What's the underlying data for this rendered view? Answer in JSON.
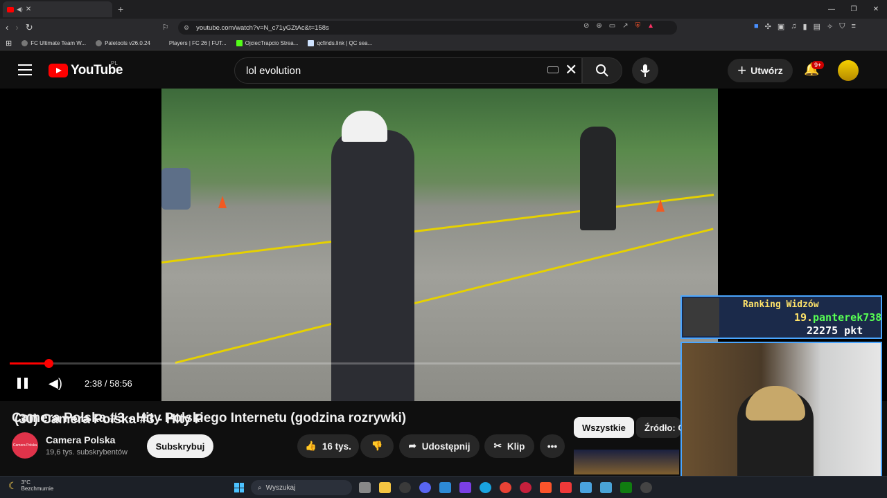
{
  "browser": {
    "tab_title": "(30) Camera Polska #3 - Hity P",
    "url": "youtube.com/watch?v=N_c71yGZtAc&t=158s",
    "bookmarks": [
      {
        "label": "FC Ultimate Team W..."
      },
      {
        "label": "Paletools v26.0.24"
      },
      {
        "label": "Players | FC 26 | FUT..."
      },
      {
        "label": "OjciecTrapcio Strea..."
      },
      {
        "label": "qcfinds.link | QC sea..."
      }
    ]
  },
  "header": {
    "logo_text": "YouTube",
    "region": "PL",
    "search_value": "lol evolution",
    "create_label": "Utwórz",
    "notification_badge": "9+"
  },
  "player": {
    "time_display": "2:38 / 58:56",
    "progress_fraction": 0.0447
  },
  "video": {
    "title": "Camera Polska #3 - Hity Polskiego Internetu (godzina rozrywki)",
    "channel_name": "Camera Polska",
    "channel_avatar_text": "Camera Polska",
    "subscribers": "19,6 tys. subskrybentów",
    "subscribe_label": "Subskrybuj",
    "likes": "16 tys.",
    "share_label": "Udostępnij",
    "clip_label": "Klip"
  },
  "sidebar_chips": [
    {
      "label": "Wszystkie",
      "active": true
    },
    {
      "label": "Źródło: C",
      "active": false
    }
  ],
  "overlay": {
    "title": "Ranking Widzów",
    "position": "19.",
    "username": "panterek738",
    "points": "22275 pkt"
  },
  "taskbar": {
    "temperature": "3°C",
    "weather": "Bezchmurnie",
    "search_placeholder": "Wyszukaj"
  },
  "colors": {
    "accent_red": "#ff0000",
    "overlay_border": "#4aa6ff",
    "overlay_gold": "#ffe36a",
    "overlay_green": "#57ff54"
  }
}
